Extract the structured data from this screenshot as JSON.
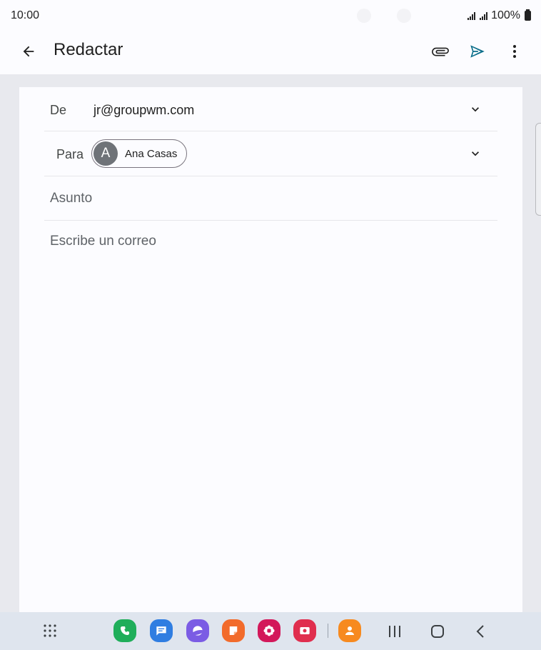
{
  "status_bar": {
    "time": "10:00",
    "battery": "100%"
  },
  "app_bar": {
    "title": "Redactar",
    "back_icon": "arrow-left-icon",
    "attach_icon": "paperclip-icon",
    "send_icon": "send-icon",
    "more_icon": "more-vert-icon"
  },
  "compose": {
    "from_label": "De",
    "from_value": "jr@groupwm.com",
    "to_label": "Para",
    "to_chip": {
      "initial": "A",
      "name": "Ana Casas"
    },
    "subject_placeholder": "Asunto",
    "body_placeholder": "Escribe un correo"
  },
  "dock": {
    "apps": [
      "apps-grid-icon",
      "phone-icon",
      "messages-icon",
      "internet-icon",
      "notes-icon",
      "gallery-icon",
      "screen-recorder-icon",
      "contacts-icon"
    ],
    "nav": [
      "recents-icon",
      "home-icon",
      "back-icon"
    ]
  },
  "colors": {
    "accent": "#0b6e8a",
    "phone": "#1fae5a",
    "messages": "#2f7de1",
    "internet": "#7b5ce4",
    "notes": "#f26b2b",
    "gallery": "#d3185a",
    "recorder": "#e02e4e",
    "contacts": "#f78a1f"
  }
}
